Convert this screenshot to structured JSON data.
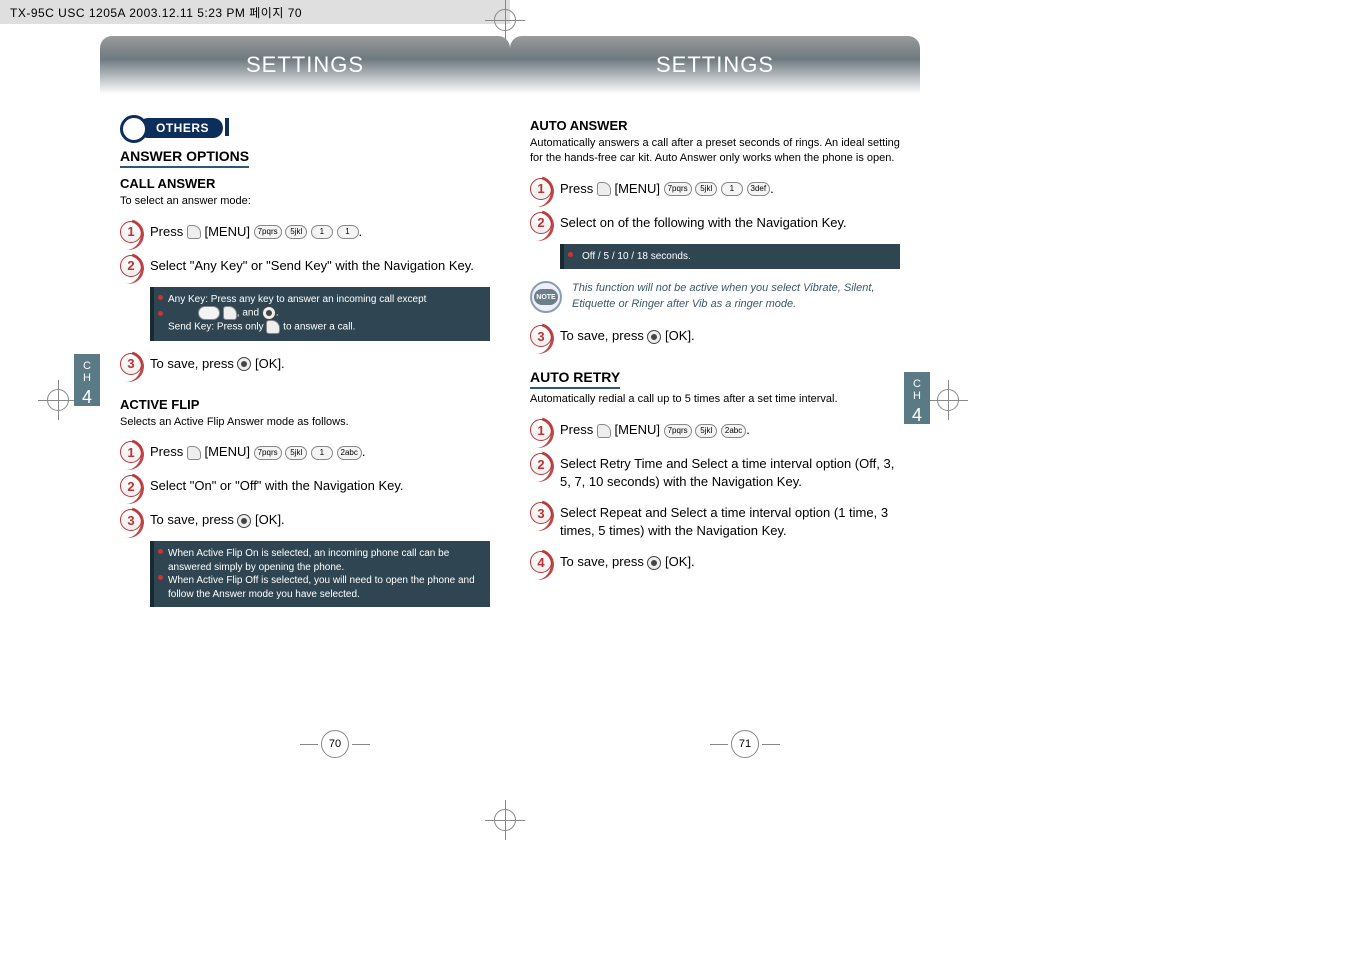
{
  "file_header": "TX-95C USC 1205A   2003.12.11 5:23 PM  페이지 70",
  "chapter_label_c": "C",
  "chapter_label_h": "H",
  "chapter_num": "4",
  "left": {
    "title": "SETTINGS",
    "pill": "OTHERS",
    "section1": "ANSWER OPTIONS",
    "sub1": "CALL ANSWER",
    "sub1_desc": "To select an answer mode:",
    "step1": "Press",
    "step1_menu": "[MENU]",
    "step2": "Select \"Any Key\" or \"Send Key\" with the Navigation Key.",
    "bar1_line1": "Any Key: Press any key to answer an incoming call except",
    "bar1_line1b": ",        , and       .",
    "bar1_line2": "Send Key: Press only       to answer a call.",
    "step3": "To save, press       [OK].",
    "sub2": "ACTIVE FLIP",
    "sub2_desc": "Selects an Active Flip Answer mode as follows.",
    "af_step1": "Press",
    "af_step1_menu": "[MENU]",
    "af_step2": "Select \"On\" or \"Off\" with the Navigation Key.",
    "af_step3": "To save, press       [OK].",
    "bar2_a": "When Active Flip On is selected, an incoming phone call can be answered simply by opening the phone.",
    "bar2_b": "When Active Flip Off is selected, you will need to open the phone and follow the Answer mode you have selected.",
    "page_num": "70"
  },
  "right": {
    "title": "SETTINGS",
    "sub1": "AUTO ANSWER",
    "sub1_desc": "Automatically answers a call after a preset seconds of rings. An ideal setting for the hands-free car kit. Auto Answer only works when the phone is open.",
    "aa_step1": "Press",
    "aa_step1_menu": "[MENU]",
    "aa_step2": "Select on of the following with the Navigation Key.",
    "aa_bar": "Off / 5 / 10 / 18 seconds.",
    "note_label": "NOTE",
    "aa_note": "This function will not be active when you select Vibrate, Silent, Etiquette or Ringer after Vib as a ringer mode.",
    "aa_step3": "To save, press       [OK].",
    "sub2": "AUTO RETRY",
    "sub2_desc": "Automatically redial a call up to 5 times after a set time interval.",
    "ar_step1": "Press",
    "ar_step1_menu": "[MENU]",
    "ar_step2": "Select Retry Time and Select a time interval option (Off, 3, 5, 7, 10 seconds) with the Navigation Key.",
    "ar_step3": "Select Repeat and Select a time interval option (1 time, 3 times, 5 times) with the Navigation Key.",
    "ar_step4": "To save, press       [OK].",
    "page_num": "71"
  }
}
